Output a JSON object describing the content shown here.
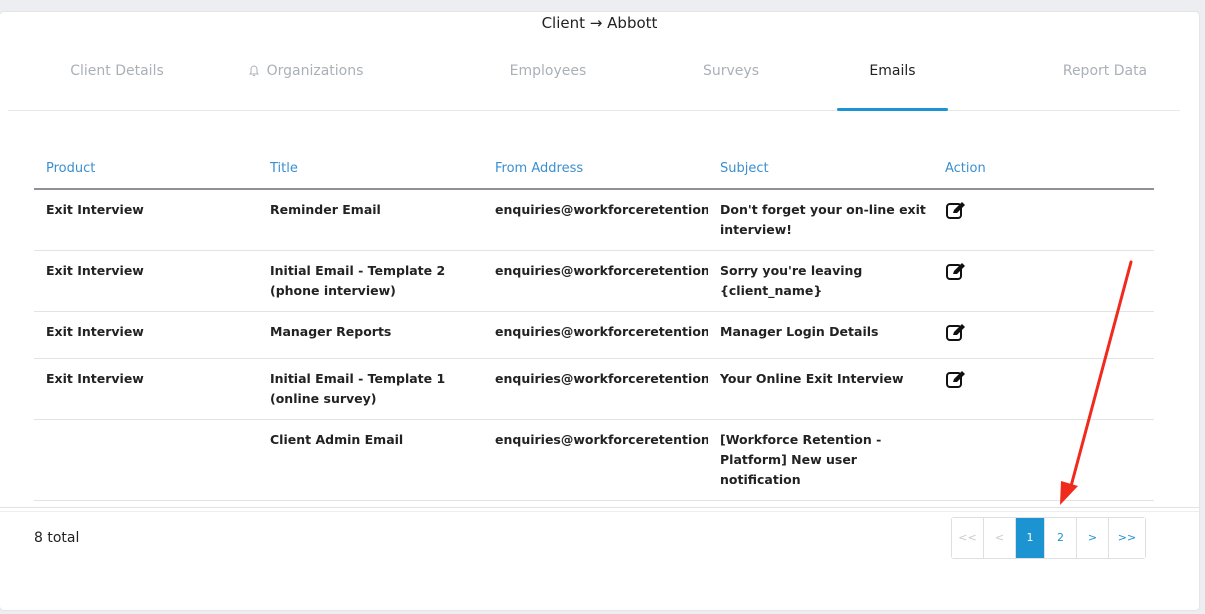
{
  "header": {
    "title_prefix": "Client",
    "title_arrow": "→",
    "title_client": "Abbott"
  },
  "tabs": [
    {
      "label": "Client Details"
    },
    {
      "label": "Organizations"
    },
    {
      "label": "Employees"
    },
    {
      "label": "Surveys"
    },
    {
      "label": "Emails"
    },
    {
      "label": "Report Data"
    }
  ],
  "active_tab": "Emails",
  "table": {
    "columns": [
      "Product",
      "Title",
      "From Address",
      "Subject",
      "Action"
    ],
    "rows": [
      {
        "product": "Exit Interview",
        "title": "Reminder Email",
        "from": "enquiries@workforceretention.cc",
        "subject": "Don't forget your on-line exit interview!",
        "has_action": true
      },
      {
        "product": "Exit Interview",
        "title": "Initial Email - Template 2 (phone interview)",
        "from": "enquiries@workforceretention.cc",
        "subject": "Sorry you're leaving {client_name}",
        "has_action": true
      },
      {
        "product": "Exit Interview",
        "title": "Manager Reports",
        "from": "enquiries@workforceretention.cc",
        "subject": "Manager Login Details",
        "has_action": true
      },
      {
        "product": "Exit Interview",
        "title": "Initial Email - Template 1 (online survey)",
        "from": "enquiries@workforceretention.cc",
        "subject": "Your Online Exit Interview",
        "has_action": true
      },
      {
        "product": "",
        "title": "Client Admin Email",
        "from": "enquiries@workforceretention.cc",
        "subject": "[Workforce Retention - Platform] New user notification",
        "has_action": false
      }
    ]
  },
  "footer": {
    "total": "8 total"
  },
  "pagination": {
    "first": "<<",
    "prev": "<",
    "pages": [
      "1",
      "2"
    ],
    "current": "1",
    "next": ">",
    "last": ">>"
  },
  "colors": {
    "accent": "#1d94d2",
    "annotation_arrow": "#f02b1d"
  }
}
